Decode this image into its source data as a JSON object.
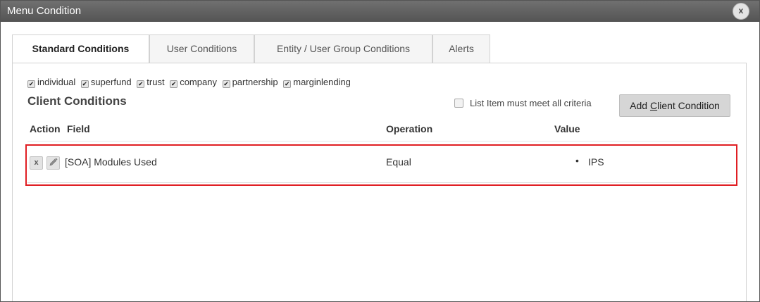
{
  "dialog": {
    "title": "Menu Condition",
    "close_label": "x"
  },
  "tabs": [
    {
      "label": "Standard Conditions",
      "active": true
    },
    {
      "label": "User Conditions",
      "active": false
    },
    {
      "label": "Entity / User Group Conditions",
      "active": false
    },
    {
      "label": "Alerts",
      "active": false
    }
  ],
  "entity_types": [
    {
      "label": "individual",
      "checked": true
    },
    {
      "label": "superfund",
      "checked": true
    },
    {
      "label": "trust",
      "checked": true
    },
    {
      "label": "company",
      "checked": true
    },
    {
      "label": "partnership",
      "checked": true
    },
    {
      "label": "marginlending",
      "checked": true
    }
  ],
  "section": {
    "title": "Client Conditions",
    "criteria_label": "List Item must meet all criteria",
    "criteria_checked": false,
    "add_button": {
      "pre": "Add ",
      "underlined": "C",
      "post": "lient Condition"
    }
  },
  "table": {
    "columns": {
      "action": "Action",
      "field": "Field",
      "operation": "Operation",
      "value": "Value"
    },
    "rows": [
      {
        "delete_label": "x",
        "edit_icon": "pencil-icon",
        "field": "[SOA] Modules Used",
        "operation": "Equal",
        "values": [
          "IPS"
        ]
      }
    ]
  },
  "colors": {
    "highlight": "#e01e23",
    "titlebar": "#5c5c5c"
  }
}
